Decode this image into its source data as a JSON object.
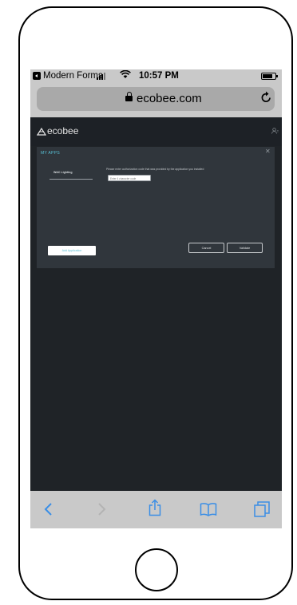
{
  "status_bar": {
    "back_app": "Modern Forms",
    "time": "10:57 PM"
  },
  "browser": {
    "url": "ecobee.com"
  },
  "app": {
    "brand": "ecobee"
  },
  "modal": {
    "title": "MY APPS",
    "app_name": "WAC Lighting",
    "instruction": "Please enter authorization code that was provided by the application you installed",
    "code_placeholder": "Enter 4 character code",
    "add_application_label": "Add Application",
    "cancel_label": "Cancel",
    "validate_label": "Validate"
  },
  "colors": {
    "accent": "#58c1d6",
    "page_background": "#1f2327",
    "panel_background": "#30363c",
    "browser_chrome": "#c9c9c9",
    "browser_icon_tint": "#3a8ee6"
  },
  "icons": {
    "status": [
      "back-app-icon",
      "signal-icon",
      "wifi-icon",
      "battery-icon"
    ],
    "toolbar": [
      "back-icon",
      "forward-icon",
      "share-icon",
      "bookmarks-icon",
      "tabs-icon"
    ]
  }
}
